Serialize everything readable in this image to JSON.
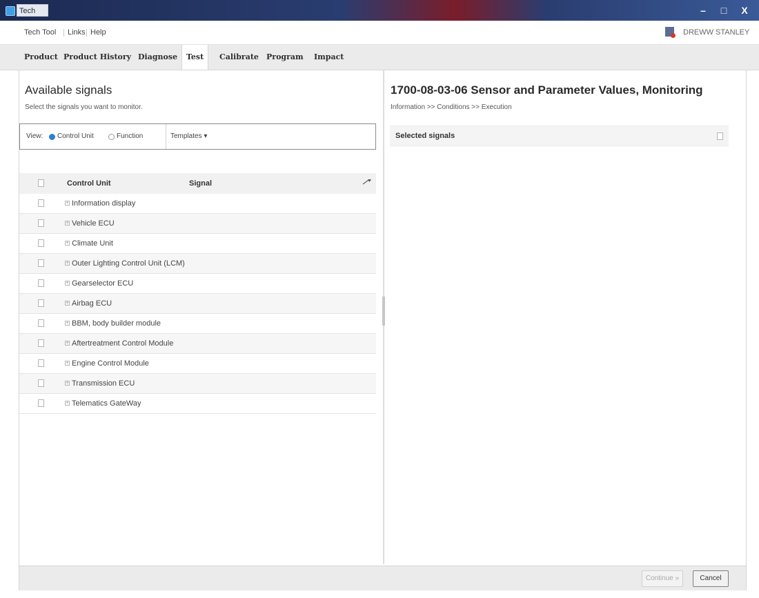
{
  "window": {
    "title": "Tech Tool",
    "controls": {
      "minimize": "–",
      "maximize": "□",
      "close": "X"
    }
  },
  "menu": {
    "items": [
      "Tech Tool",
      "Links",
      "Help"
    ],
    "user": "DREWW STANLEY"
  },
  "tabs": [
    "Product",
    "Product History",
    "Diagnose",
    "Test",
    "Calibrate",
    "Program",
    "Impact"
  ],
  "active_tab": "Test",
  "left": {
    "title": "Available signals",
    "subtitle": "Select the signals you want to monitor.",
    "view": {
      "label": "View:",
      "options": [
        "Control Unit",
        "Function"
      ],
      "selected": "Control Unit",
      "templates": "Templates ▾"
    },
    "columns": [
      "Control Unit",
      "Signal"
    ],
    "rows": [
      "Information display",
      "Vehicle ECU",
      "Climate Unit",
      "Outer Lighting Control Unit (LCM)",
      "Gearselector ECU",
      "Airbag ECU",
      "BBM, body builder module",
      "Aftertreatment Control Module",
      "Engine Control Module",
      "Transmission ECU",
      "Telematics GateWay"
    ]
  },
  "right": {
    "title": "1700-08-03-06 Sensor and Parameter Values, Monitoring",
    "breadcrumb": "Information >> Conditions >> Execution",
    "selected_label": "Selected signals"
  },
  "footer": {
    "continue": "Continue »",
    "cancel": "Cancel"
  },
  "colors": {
    "accent": "#2d7fd6",
    "titlebar": "#1c2a52"
  }
}
